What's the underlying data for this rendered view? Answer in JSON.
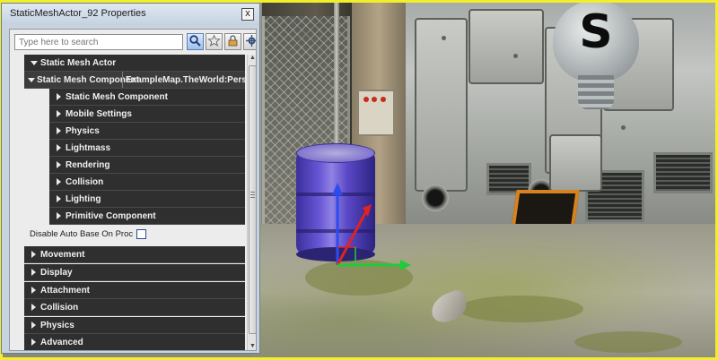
{
  "window": {
    "title": "StaticMeshActor_92 Properties",
    "close_glyph": "x"
  },
  "search": {
    "placeholder": "Type here to search",
    "buttons": [
      "search-icon",
      "star-icon",
      "lock-icon",
      "settings-icon"
    ]
  },
  "categories": {
    "static_mesh_actor": "Static Mesh Actor",
    "component_row": {
      "label": "Static Mesh Component",
      "value": "ExampleMap.TheWorld:PersistentLevel"
    },
    "sub_items": [
      "Static Mesh Component",
      "Mobile Settings",
      "Physics",
      "Lightmass",
      "Rendering",
      "Collision",
      "Lighting",
      "Primitive Component"
    ],
    "property": {
      "label": "Disable Auto Base On Proc Building",
      "checked": false
    },
    "top_level": [
      "Movement",
      "Display",
      "Attachment",
      "Collision",
      "Physics",
      "Advanced"
    ]
  },
  "viewport": {
    "bulb_letter": "S",
    "accent_color": "#f2ef2a"
  },
  "colors": {
    "category_bg": "#2f2f2f",
    "panel_bg": "#ececec",
    "title_bg": "#c5d2e0"
  }
}
